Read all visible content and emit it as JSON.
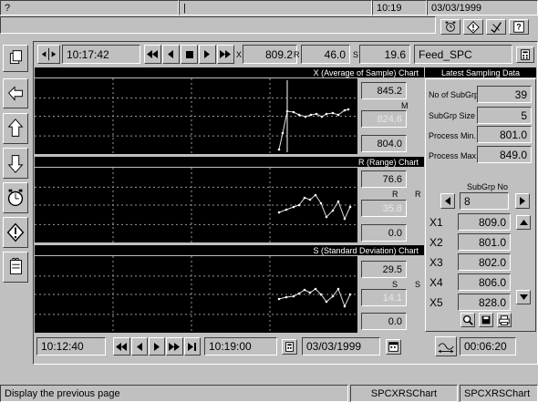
{
  "top": {
    "left_label": "?",
    "mid_label": "|",
    "time": "10:19",
    "date": "03/03/1999"
  },
  "toolbar": {
    "time": "10:17:42",
    "value_x": "809.2",
    "value_r": "46.0",
    "value_s": "19.6",
    "tag": "Feed_SPC",
    "x_mark": "X",
    "r_mark": "R",
    "s_mark": "S"
  },
  "charts": {
    "x": {
      "title": "X (Average of Sample) Chart",
      "ucl": "845.2",
      "mid_label": "M",
      "mean": "824.6",
      "lcl": "804.0"
    },
    "r": {
      "title": "R (Range) Chart",
      "ucl": "76.6",
      "mid_label": "R",
      "mid_label2": "R",
      "mean": "35.8",
      "lcl": "0.0"
    },
    "s": {
      "title": "S (Standard Deviation) Chart",
      "ucl": "29.5",
      "mid_label": "S",
      "mid_label2": "S",
      "mean": "14.1",
      "lcl": "0.0"
    }
  },
  "latest": {
    "title": "Latest Sampling Data",
    "no_subgrp_label": "No of SubGrp",
    "no_subgrp": "39",
    "subgrp_size_label": "SubGrp Size",
    "subgrp_size": "5",
    "proc_min_label": "Process Min.",
    "proc_min": "801.0",
    "proc_max_label": "Process Max.",
    "proc_max": "849.0",
    "subgrp_no_label": "SubGrp No",
    "subgrp_no": "8",
    "x_rows": [
      {
        "label": "X1",
        "value": "809.0"
      },
      {
        "label": "X2",
        "value": "801.0"
      },
      {
        "label": "X3",
        "value": "802.0"
      },
      {
        "label": "X4",
        "value": "806.0"
      },
      {
        "label": "X5",
        "value": "828.0"
      }
    ]
  },
  "bottom": {
    "start_time": "10:12:40",
    "end_time": "10:19:00",
    "date": "03/03/1999",
    "span": "00:06:20"
  },
  "status": {
    "message": "Display the previous page",
    "panel1": "SPCXRSChart",
    "panel2": "SPCXRSChart"
  }
}
